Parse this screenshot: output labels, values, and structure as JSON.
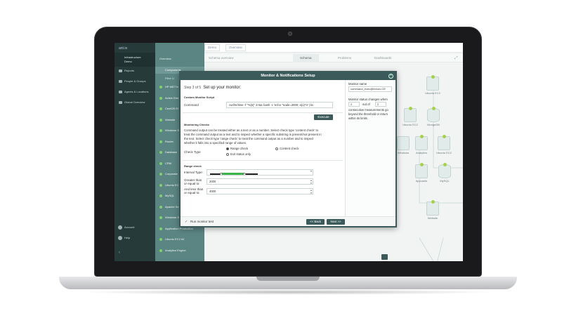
{
  "app": {
    "logo": "ant.io",
    "workspace": [
      "Infrastructure",
      "Demo"
    ]
  },
  "nav": {
    "items": [
      {
        "label": "Reports",
        "icon": "reports-icon"
      },
      {
        "label": "People & Groups",
        "icon": "people-icon"
      },
      {
        "label": "Agents & Locations",
        "icon": "agents-icon"
      },
      {
        "label": "Global Overview",
        "icon": "globe-icon"
      }
    ],
    "account": "Account",
    "help": "Help",
    "collapse": "‹"
  },
  "list": {
    "tab_overview": "Overview",
    "header": "Components",
    "filter": "Filter Li",
    "items": [
      "HP M577e",
      "Active Dire",
      "CentOS El",
      "Website",
      "Windows Se",
      "Router",
      "Database",
      "CRM",
      "Corporate",
      "Ubuntu EC",
      "MySQL",
      "Apache Se",
      "Windows Se",
      "Application Production",
      "Ubuntu EC2 #2",
      "Analytics Engine"
    ]
  },
  "topbar": {
    "crumb1": "Demo",
    "crumb2": "Overview",
    "schema_label": "Schema overview",
    "tabs": [
      "Schema",
      "Problems",
      "Dashboards"
    ],
    "active_tab": "Schema"
  },
  "canvas": {
    "nodes": [
      "Ubuntu EC2",
      "Ubuntu EC2",
      "MongoDB",
      "Windows",
      "Analytics",
      "Ubuntu EC2",
      "Appcasts",
      "MySQL",
      "Website"
    ]
  },
  "modal": {
    "title": "Monitor & Notifications Setup",
    "step": "Step 3 of 5",
    "step_title": "Set up your monitor:",
    "custom_section": "Custom Monitor Script",
    "command_label": "Command",
    "command_value": "curl/m/time -f \"%{s}\" 2>&1 bash -c 'echo \"scale=2000; a(1)*4' | bc",
    "execute": "Execute",
    "checks_section": "Monitoring Checks",
    "checks_text": "Command output can be treated either as a text or as a number. Select check type 'content check' to treat the command output as a text and to inspect whether a specific substring is present/not present in the text. Select check type 'range check' to treat the command output as a number and to inspect whether it falls into a specified range of values.",
    "check_type_label": "Check Type",
    "range_check": "Range check",
    "content_check": "Content check",
    "exit_status": "Exit status only",
    "range_section": "Range check",
    "interval_label": "Interval Type:",
    "greater_label": "Greater than or equal to:",
    "greater_value": "2000",
    "less_label": "And less than or equal to:",
    "less_value": "4000",
    "run_test": "Run monitor test",
    "back": "<< Back",
    "next": "Next >>",
    "right": {
      "name_label": "Monitor name",
      "name_value": "command_exec@ecturo.CE",
      "status_label": "Monitor status changes when",
      "count": "2",
      "out_of": "out of",
      "total": "2",
      "description": "consecutive measurements go beyond the threshold or return within its limits."
    }
  }
}
